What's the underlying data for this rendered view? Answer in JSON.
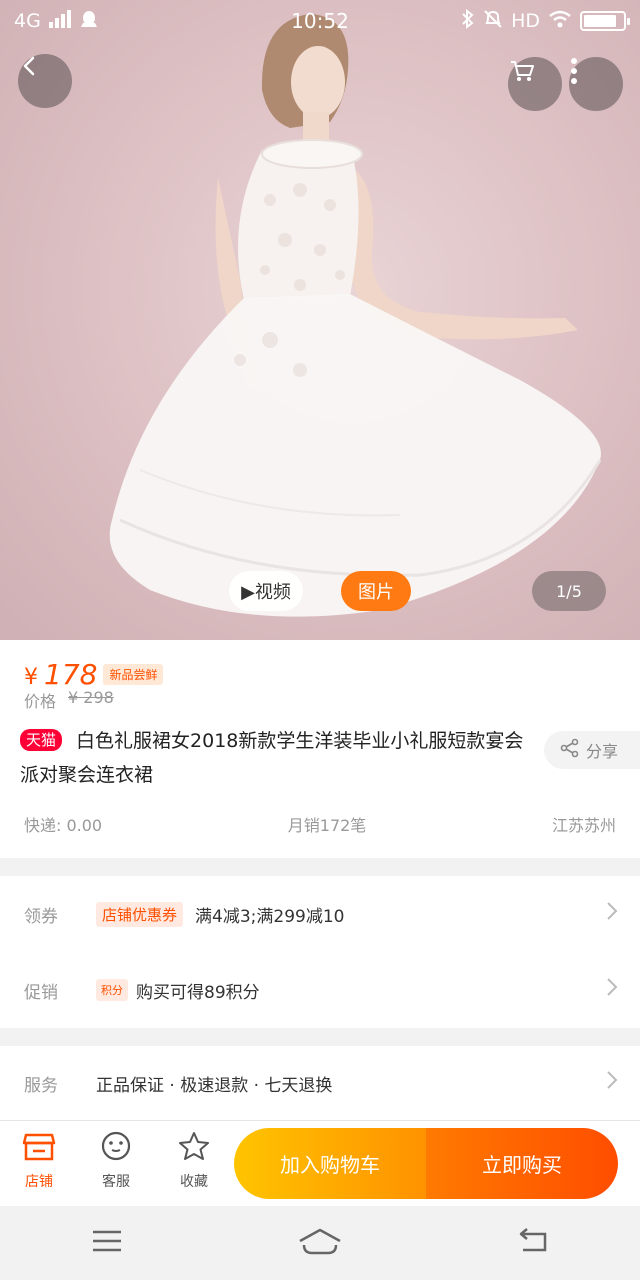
{
  "status_bar": {
    "network": "4G",
    "time": "10:52",
    "hd": "HD",
    "battery_level": 0.85
  },
  "hero": {
    "video_label": "▶视频",
    "photo_label": "图片",
    "image_counter": "1/5",
    "icons": {
      "back": "back-arrow-icon",
      "cart": "cart-icon",
      "more": "more-dots-icon"
    }
  },
  "product": {
    "currency": "¥",
    "price": "178",
    "new_badge": "新品尝鲜",
    "orig_label": "价格",
    "orig_price": "¥ 298",
    "tmall_badge": "天猫",
    "title": "白色礼服裙女2018新款学生洋装毕业小礼服短款宴会派对聚会连衣裙",
    "share": "分享",
    "shipping": "快递: 0.00",
    "monthly_sales": "月销172笔",
    "location": "江苏苏州"
  },
  "details": {
    "coupon": {
      "label": "领券",
      "tag": "店铺优惠券",
      "text": "满4减3;满299减10"
    },
    "promo": {
      "label": "促销",
      "tag": "积分",
      "text": "购买可得89积分"
    },
    "service": {
      "label": "服务",
      "text": "正品保证 · 极速退款 · 七天退换"
    }
  },
  "action_bar": {
    "shop": "店铺",
    "service": "客服",
    "favorite": "收藏",
    "add_to_cart": "加入购物车",
    "buy_now": "立即购买"
  },
  "colors": {
    "accent": "#ff5000",
    "tmall_red": "#ff0036",
    "cart_gradient_start": "#ffc400",
    "buy_gradient_end": "#ff4d00"
  }
}
